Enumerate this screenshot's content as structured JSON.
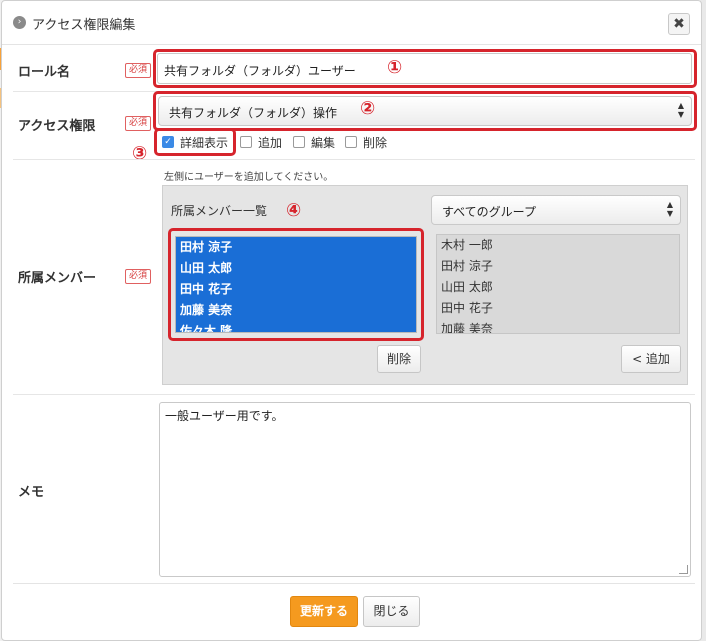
{
  "dialog": {
    "title": "アクセス権限編集",
    "close_label": "✖"
  },
  "required_badge": "必須",
  "role": {
    "label": "ロール名",
    "value": "共有フォルダ（フォルダ）ユーザー",
    "marker": "①"
  },
  "access": {
    "label": "アクセス権限",
    "selected": "共有フォルダ（フォルダ）操作",
    "marker": "②",
    "checkboxes": [
      {
        "label": "詳細表示",
        "checked": true
      },
      {
        "label": "追加",
        "checked": false
      },
      {
        "label": "編集",
        "checked": false
      },
      {
        "label": "削除",
        "checked": false
      }
    ],
    "detail_marker": "③"
  },
  "members": {
    "label": "所属メンバー",
    "hint": "左側にユーザーを追加してください。",
    "list_title": "所属メンバー一覧",
    "marker": "④",
    "group_select": "すべてのグループ",
    "selected_members": [
      "田村 涼子",
      "山田 太郎",
      "田中 花子",
      "加藤 美奈",
      "佐々木 隆"
    ],
    "available_users": [
      "木村 一郎",
      "田村 涼子",
      "山田 太郎",
      "田中 花子",
      "加藤 美奈"
    ],
    "remove_button": "削除",
    "add_button": "< 追加"
  },
  "memo": {
    "label": "メモ",
    "value": "一般ユーザー用です。"
  },
  "footer": {
    "update_button": "更新する",
    "close_button": "閉じる"
  },
  "colors": {
    "accent_red": "#d6242c",
    "primary_orange": "#f59a1f",
    "selection_blue": "#1a6ed6"
  }
}
